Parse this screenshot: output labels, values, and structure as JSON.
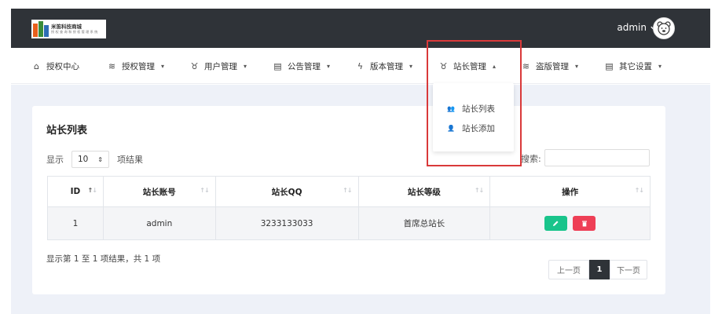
{
  "header": {
    "logo": {
      "title": "米笛科技商城",
      "subtitle": "授 权 查 询 和 授 权 管 理 系 统"
    },
    "user": {
      "name": "admin",
      "chevron_icon": "chevron-down-icon",
      "avatar_icon": "avatar-bear-icon"
    }
  },
  "nav": {
    "items": [
      {
        "label": "授权中心",
        "icon": "home-icon"
      },
      {
        "label": "授权管理",
        "icon": "layers-icon",
        "has_dropdown": true
      },
      {
        "label": "用户管理",
        "icon": "user-mask-icon",
        "has_dropdown": true
      },
      {
        "label": "公告管理",
        "icon": "document-icon",
        "has_dropdown": true
      },
      {
        "label": "版本管理",
        "icon": "bolt-icon",
        "has_dropdown": true
      },
      {
        "label": "站长管理",
        "icon": "user-mask-icon",
        "has_dropdown": true,
        "expanded": true
      },
      {
        "label": "盗版管理",
        "icon": "layers-icon",
        "has_dropdown": true
      },
      {
        "label": "其它设置",
        "icon": "document-icon",
        "has_dropdown": true
      }
    ],
    "dropdown": {
      "items": [
        {
          "label": "站长列表",
          "icon": "users-icon"
        },
        {
          "label": "站长添加",
          "icon": "user-add-icon"
        }
      ]
    }
  },
  "card": {
    "title": "站长列表",
    "length": {
      "prefix": "显示",
      "value": "10",
      "suffix": "项结果"
    },
    "search": {
      "label": "搜索:",
      "value": ""
    },
    "table": {
      "columns": [
        "ID",
        "站长账号",
        "站长QQ",
        "站长等级",
        "操作"
      ],
      "rows": [
        {
          "id": "1",
          "account": "admin",
          "qq": "3233133033",
          "level": "首席总站长"
        }
      ]
    },
    "info": "显示第 1 至 1 项结果，共 1 项",
    "pagination": {
      "prev": "上一页",
      "current": "1",
      "next": "下一页"
    }
  },
  "colors": {
    "header_bg": "#2f3338",
    "edit_button": "#19c48b",
    "delete_button": "#ee3f56",
    "highlight_border": "#d9393a",
    "page_bg": "#eef1f8"
  }
}
